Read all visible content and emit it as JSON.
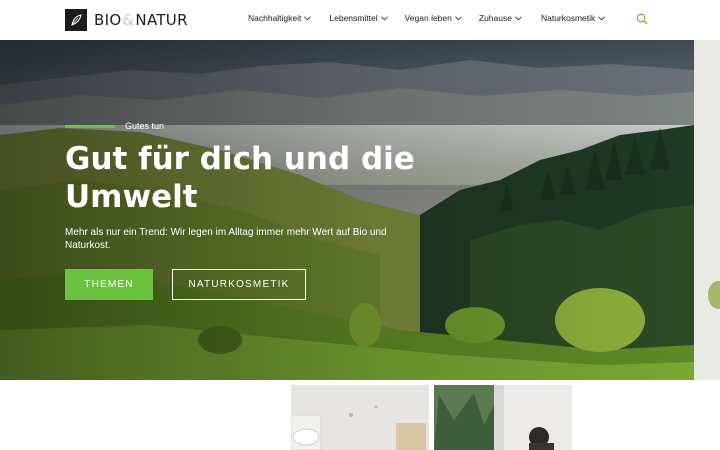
{
  "brand": {
    "name_left": "BIO",
    "name_amp": "&",
    "name_right": "NATUR"
  },
  "nav": {
    "items": [
      {
        "label": "Nachhaltigkeit"
      },
      {
        "label": "Lebensmittel"
      },
      {
        "label": "Vegan leben"
      },
      {
        "label": "Zuhause"
      },
      {
        "label": "Naturkosmetik"
      }
    ],
    "search_icon": "search-icon"
  },
  "hero": {
    "eyebrow": "Gutes tun",
    "title": "Gut für dich und die Umwelt",
    "subtitle": "Mehr als nur ein Trend: Wir legen im Alltag immer mehr Wert auf Bio und Naturkost.",
    "primary_button": "THEMEN",
    "secondary_button": "NATURKOSMETIK"
  },
  "colors": {
    "accent": "#6ac23e",
    "text_dark": "#1c1c1c",
    "white": "#ffffff"
  }
}
